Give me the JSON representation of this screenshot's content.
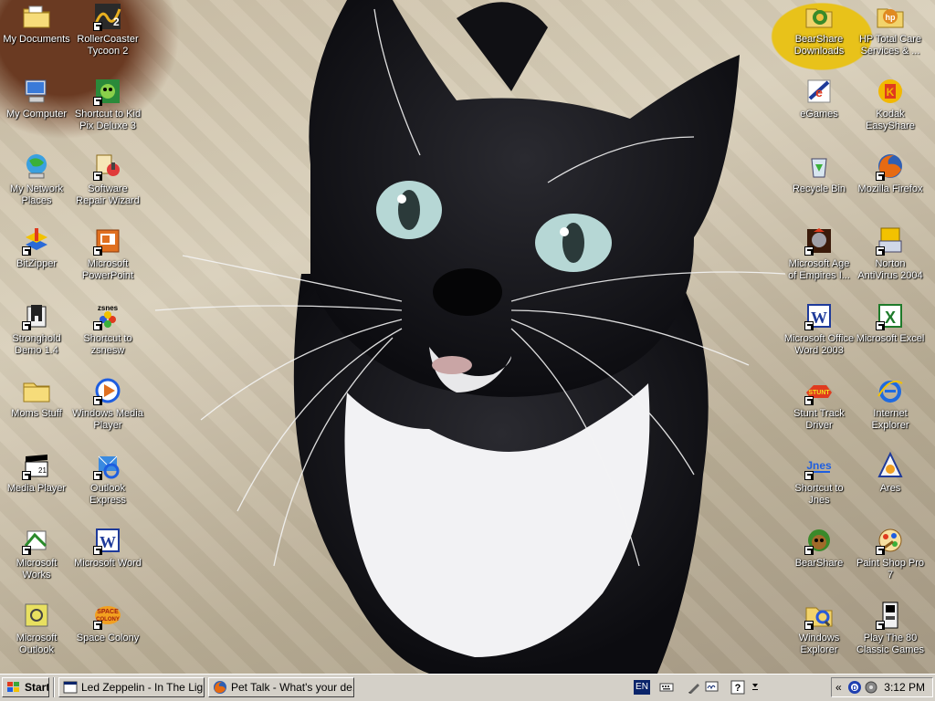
{
  "desktop": {
    "left_icons": [
      {
        "label": "My Documents",
        "icon": "folder-documents-icon",
        "shortcut": false
      },
      {
        "label": "My Computer",
        "icon": "computer-icon",
        "shortcut": false
      },
      {
        "label": "My Network Places",
        "icon": "network-icon",
        "shortcut": false
      },
      {
        "label": "BitZipper",
        "icon": "bitzipper-icon",
        "shortcut": true
      },
      {
        "label": "Stronghold Demo 1.4",
        "icon": "castle-icon",
        "shortcut": true
      },
      {
        "label": "Moms Stuff",
        "icon": "folder-icon",
        "shortcut": false
      },
      {
        "label": "Media Player",
        "icon": "clapperboard-icon",
        "shortcut": true
      },
      {
        "label": "Microsoft Works",
        "icon": "works-icon",
        "shortcut": true
      },
      {
        "label": "Microsoft Outlook",
        "icon": "outlook-icon",
        "shortcut": false
      }
    ],
    "left2_icons": [
      {
        "label": "RollerCoaster Tycoon 2",
        "icon": "rollercoaster-icon",
        "shortcut": true
      },
      {
        "label": "Shortcut to Kid Pix Deluxe 3",
        "icon": "kidpix-icon",
        "shortcut": true
      },
      {
        "label": "Software Repair Wizard",
        "icon": "repair-wizard-icon",
        "shortcut": true
      },
      {
        "label": "Microsoft PowerPoint",
        "icon": "powerpoint-icon",
        "shortcut": true
      },
      {
        "label": "Shortcut to zsnesw",
        "icon": "zsnes-icon",
        "shortcut": true
      },
      {
        "label": "Windows Media Player",
        "icon": "media-player-icon",
        "shortcut": true
      },
      {
        "label": "Outlook Express",
        "icon": "outlook-express-icon",
        "shortcut": true
      },
      {
        "label": "Microsoft Word",
        "icon": "word-icon",
        "shortcut": true
      },
      {
        "label": "Space Colony",
        "icon": "space-colony-icon",
        "shortcut": true
      }
    ],
    "right1_icons": [
      {
        "label": "BearShare Downloads",
        "icon": "folder-bearshare-icon",
        "shortcut": false
      },
      {
        "label": "eGames",
        "icon": "egames-icon",
        "shortcut": false
      },
      {
        "label": "Recycle Bin",
        "icon": "recycle-bin-icon",
        "shortcut": false
      },
      {
        "label": "Microsoft Age of Empires I...",
        "icon": "age-of-empires-icon",
        "shortcut": true
      },
      {
        "label": "Microsoft Office Word 2003",
        "icon": "word-icon",
        "shortcut": true
      },
      {
        "label": "Stunt Track Driver",
        "icon": "stunt-track-icon",
        "shortcut": true
      },
      {
        "label": "Shortcut to Jnes",
        "icon": "jnes-icon",
        "shortcut": true
      },
      {
        "label": "BearShare",
        "icon": "bearshare-icon",
        "shortcut": true
      },
      {
        "label": "Windows Explorer",
        "icon": "explorer-icon",
        "shortcut": true
      }
    ],
    "right2_icons": [
      {
        "label": "HP Total Care Services & ...",
        "icon": "hp-folder-icon",
        "shortcut": false
      },
      {
        "label": "Kodak EasyShare",
        "icon": "kodak-icon",
        "shortcut": false
      },
      {
        "label": "Mozilla Firefox",
        "icon": "firefox-icon",
        "shortcut": true
      },
      {
        "label": "Norton AntiVirus 2004",
        "icon": "norton-icon",
        "shortcut": true
      },
      {
        "label": "Microsoft Excel",
        "icon": "excel-icon",
        "shortcut": true
      },
      {
        "label": "Internet Explorer",
        "icon": "ie-icon",
        "shortcut": false
      },
      {
        "label": "Ares",
        "icon": "ares-icon",
        "shortcut": false
      },
      {
        "label": "Paint Shop Pro 7",
        "icon": "paint-shop-icon",
        "shortcut": true
      },
      {
        "label": "Play The 80 Classic Games",
        "icon": "arcade-icon",
        "shortcut": true
      }
    ]
  },
  "taskbar": {
    "start_label": "Start",
    "tasks": [
      {
        "label": "Led Zeppelin - In The Lig...",
        "icon": "app-window-icon"
      },
      {
        "label": "Pet Talk - What's your de...",
        "icon": "firefox-icon"
      }
    ],
    "language": "EN",
    "tray_chevron": "«",
    "clock": "3:12 PM"
  },
  "colors": {
    "taskbar": "#d4d0c8",
    "title_blue": "#0a246a",
    "desktop_text": "#ffffff"
  }
}
